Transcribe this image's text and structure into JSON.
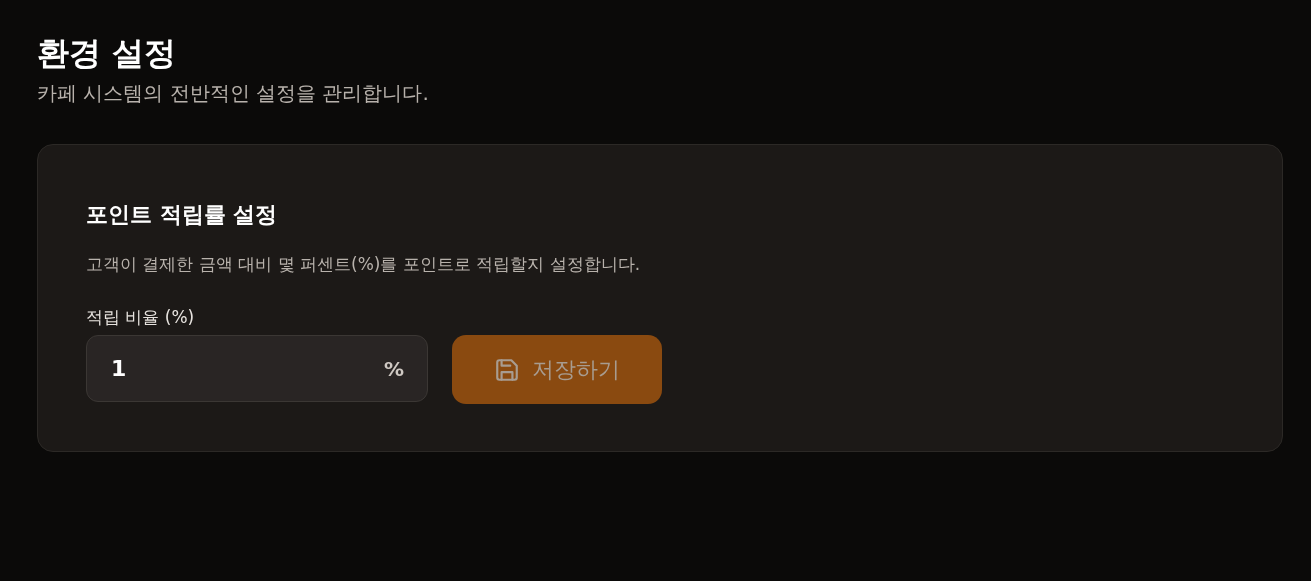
{
  "header": {
    "title": "환경 설정",
    "subtitle": "카페 시스템의 전반적인 설정을 관리합니다."
  },
  "card": {
    "title": "포인트 적립률 설정",
    "description": "고객이 결제한 금액 대비 몇 퍼센트(%)를 포인트로 적립할지 설정합니다.",
    "field": {
      "label": "적립 비율 (%)",
      "value": "1",
      "unit": "%"
    },
    "save_button": {
      "label": "저장하기",
      "disabled": true
    }
  }
}
